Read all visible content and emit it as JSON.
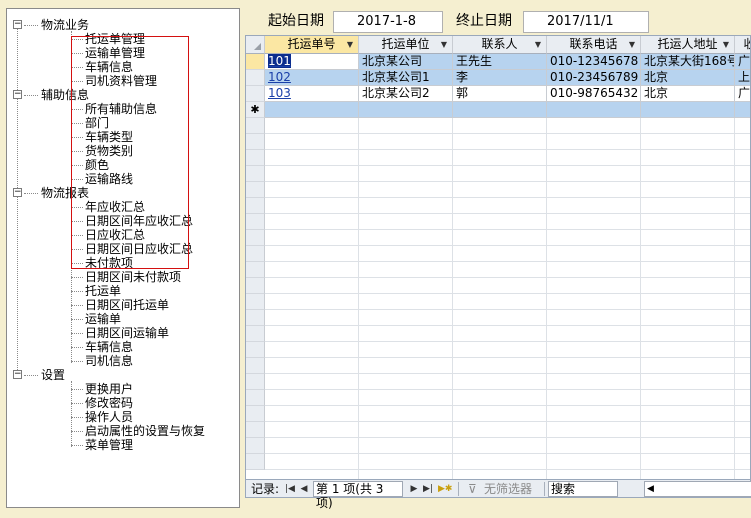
{
  "tree": {
    "groups": [
      {
        "label": "物流业务",
        "expander": "⊟",
        "items": [
          "托运单管理",
          "运输单管理",
          "车辆信息",
          "司机资料管理"
        ]
      },
      {
        "label": "辅助信息",
        "expander": "⊟",
        "items": [
          "所有辅助信息",
          "部门",
          "车辆类型",
          "货物类别",
          "颜色",
          "运输路线"
        ]
      },
      {
        "label": "物流报表",
        "expander": "⊟",
        "items": [
          "年应收汇总",
          "日期区间年应收汇总",
          "日应收汇总",
          "日期区间日应收汇总",
          "未付款项",
          "日期区间未付款项",
          "托运单",
          "日期区间托运单",
          "运输单",
          "日期区间运输单",
          "车辆信息",
          "司机信息"
        ]
      },
      {
        "label": "设置",
        "expander": "⊟",
        "items": [
          "更换用户",
          "修改密码",
          "操作人员",
          "启动属性的设置与恢复",
          "菜单管理"
        ]
      }
    ]
  },
  "filter": {
    "start_label": "起始日期",
    "start_value": "2017-1-8",
    "end_label": "终止日期",
    "end_value": "2017/11/1"
  },
  "sheet": {
    "columns": [
      "托运单号",
      "托运单位",
      "联系人",
      "联系电话",
      "托运人地址",
      "收"
    ],
    "rows": [
      [
        "101",
        "北京某公司",
        "王先生",
        "010-12345678",
        "北京某大街168号",
        "广"
      ],
      [
        "102",
        "北京某公司1",
        "李",
        "010-23456789",
        "北京",
        "上"
      ],
      [
        "103",
        "北京某公司2",
        "郭",
        "010-98765432",
        "北京",
        "广"
      ]
    ],
    "new_row_marker": "✱"
  },
  "navbar": {
    "record_label": "记录:",
    "first_icon": "first-record-icon",
    "prev_icon": "prev-record-icon",
    "position": "第 1 项(共 3 项)",
    "next_icon": "next-record-icon",
    "last_icon": "last-record-icon",
    "new_icon": "new-record-icon",
    "filter_label": "无筛选器",
    "search_placeholder": "搜索"
  },
  "colors": {
    "background": "#f5efd0",
    "selected_row": "#b7d3ef",
    "active_header": "#fbe7a3",
    "highlight_box": "#d41010",
    "link": "#1a3fa8"
  }
}
